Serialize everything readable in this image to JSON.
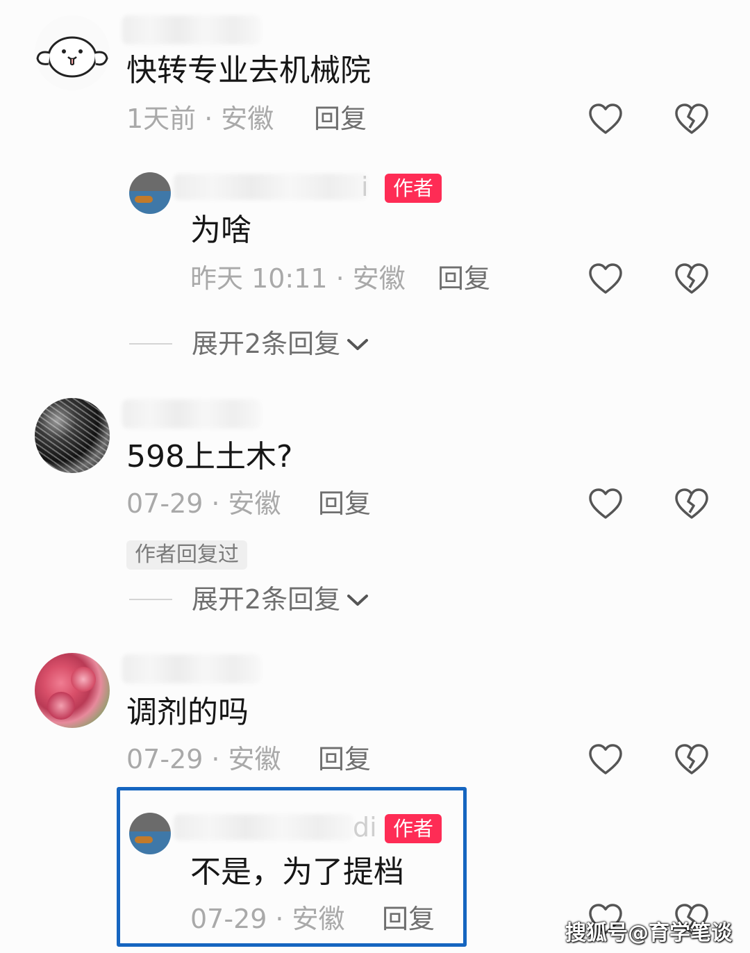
{
  "comments": [
    {
      "text": "快转专业去机械院",
      "time": "1天前",
      "location": "安徽",
      "reply_label": "回复",
      "avatar_icon": "cartoon-seal-icon",
      "sub_reply": {
        "username_suffix": "i",
        "badge": "作者",
        "text": "为啥",
        "time": "昨天 10:11",
        "location": "安徽",
        "reply_label": "回复"
      },
      "expand_label": "展开2条回复"
    },
    {
      "text": "598上土木?",
      "time": "07-29",
      "location": "安徽",
      "reply_label": "回复",
      "replied_tag": "作者回复过",
      "expand_label": "展开2条回复"
    },
    {
      "text": "调剂的吗",
      "time": "07-29",
      "location": "安徽",
      "reply_label": "回复",
      "sub_reply": {
        "username_suffix": "di",
        "badge": "作者",
        "text": "不是，为了提档",
        "time": "07-29",
        "location": "安徽",
        "reply_label": "回复"
      }
    }
  ],
  "separator": "·",
  "watermark": "搜狐号@育学笔谈",
  "colors": {
    "badge": "#fe2c55",
    "highlight_box": "#1565c0",
    "meta_text": "#a9a9a9",
    "icon_stroke": "#555555"
  },
  "icons": {
    "like": "heart-outline-icon",
    "dislike": "broken-heart-icon",
    "expand": "chevron-down-icon"
  }
}
